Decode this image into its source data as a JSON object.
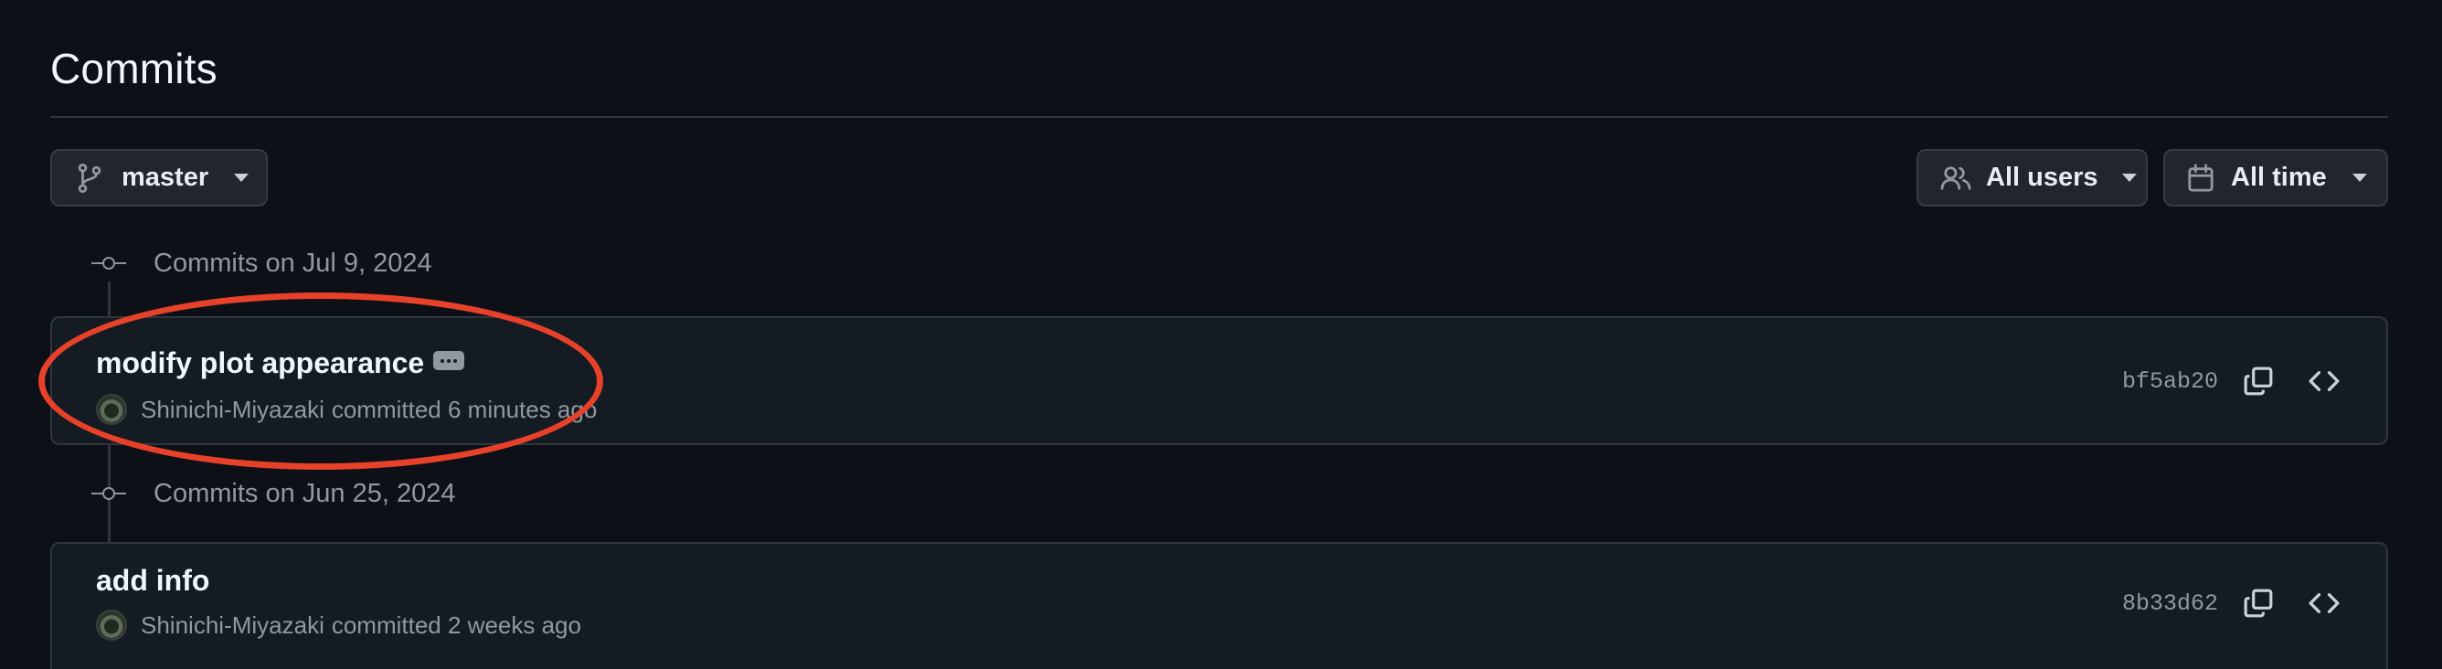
{
  "header": {
    "title": "Commits"
  },
  "filters": {
    "branch": {
      "label": "master",
      "icon": "git-branch-icon"
    },
    "users": {
      "label": "All users",
      "icon": "people-icon"
    },
    "time": {
      "label": "All time",
      "icon": "calendar-icon"
    }
  },
  "groups": [
    {
      "label": "Commits on Jul 9, 2024",
      "commits": [
        {
          "message": "modify plot appearance",
          "author": "Shinichi-Miyazaki",
          "meta": "committed 6 minutes ago",
          "sha": "bf5ab20"
        }
      ]
    },
    {
      "label": "Commits on Jun 25, 2024",
      "commits": [
        {
          "message": "add info",
          "author": "Shinichi-Miyazaki",
          "meta": "committed 2 weeks ago",
          "sha": "8b33d62"
        }
      ]
    }
  ],
  "colors": {
    "background": "#0d1117",
    "card": "#151b23",
    "border": "#30363d",
    "annotation": "#e8412a"
  }
}
